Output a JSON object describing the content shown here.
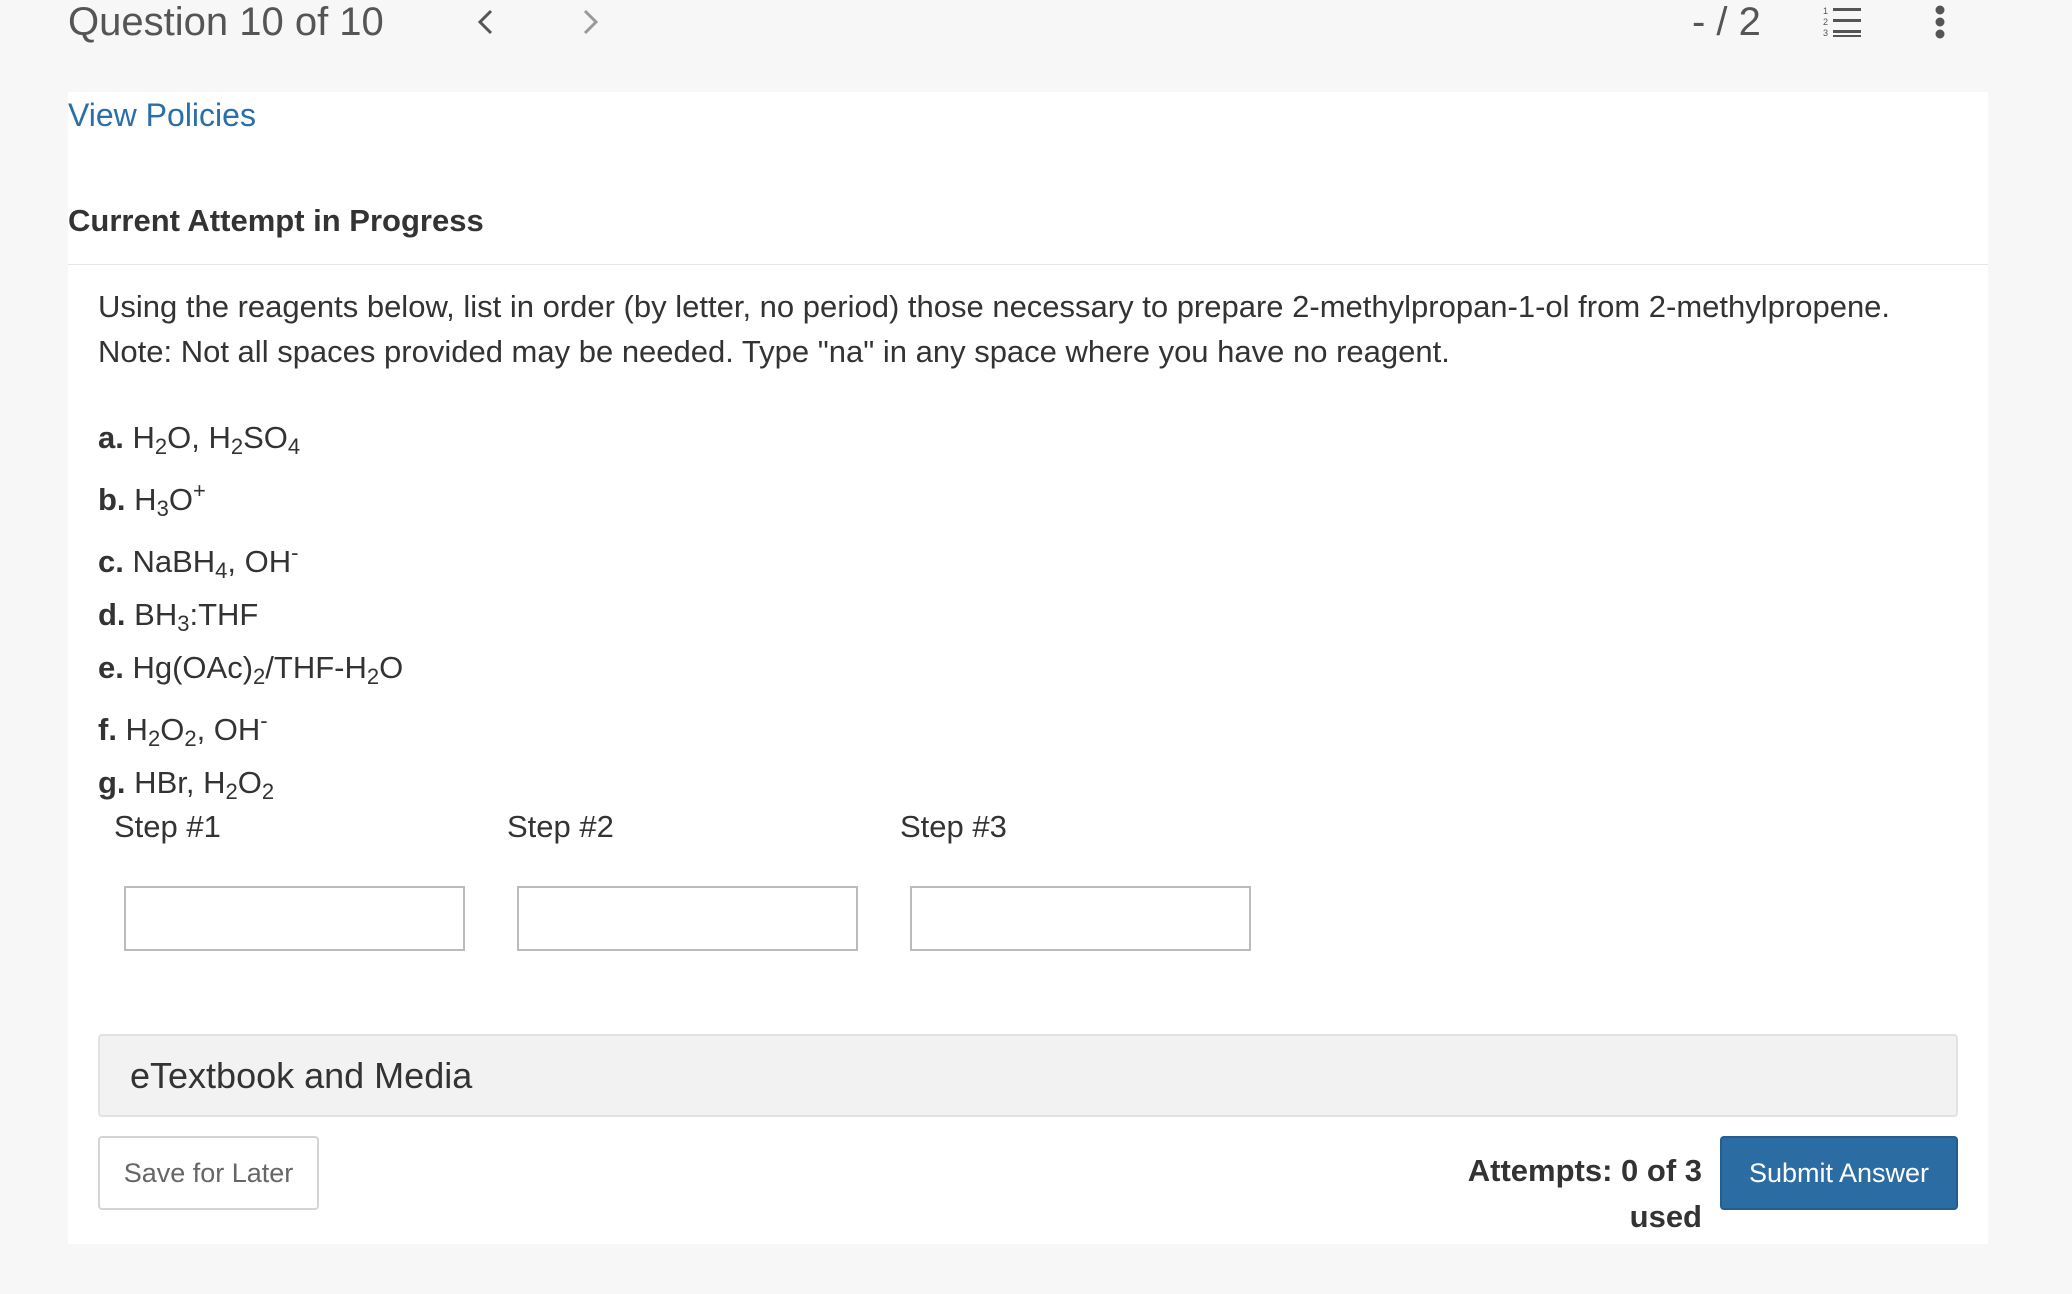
{
  "header": {
    "question_label": "Question 10 of 10",
    "score": "- / 2"
  },
  "links": {
    "view_policies": "View Policies"
  },
  "attempt_heading": "Current Attempt in Progress",
  "prompt": {
    "line1": "Using the reagents below, list in order (by letter, no period) those necessary to prepare 2-methylpropan-1-ol from 2-methylpropene.",
    "line2": "Note: Not all spaces provided may be needed. Type \"na\" in any space where you have no reagent."
  },
  "reagents": [
    {
      "letter": "a.",
      "text": "H<sub>2</sub>O, H<sub>2</sub>SO<sub>4</sub>"
    },
    {
      "letter": "b.",
      "text": "H<sub>3</sub>O<sup>+</sup>"
    },
    {
      "letter": "c.",
      "text": "NaBH<sub>4</sub>, OH<sup>-</sup>"
    },
    {
      "letter": "d.",
      "text": "BH<sub>3</sub>:THF"
    },
    {
      "letter": "e.",
      "text": "Hg(OAc)<sub>2</sub>/THF-H<sub>2</sub>O"
    },
    {
      "letter": "f.",
      "text": "H<sub>2</sub>O<sub>2</sub>, OH<sup>-</sup>"
    },
    {
      "letter": "g.",
      "text": "HBr, H<sub>2</sub>O<sub>2</sub>"
    }
  ],
  "steps": [
    {
      "label": "Step #1",
      "value": ""
    },
    {
      "label": "Step #2",
      "value": ""
    },
    {
      "label": "Step #3",
      "value": ""
    }
  ],
  "etextbook_label": "eTextbook and Media",
  "footer": {
    "save_label": "Save for Later",
    "attempts_text": "Attempts: 0 of 3 used",
    "submit_label": "Submit Answer"
  },
  "colors": {
    "accent": "#2b6da3",
    "link": "#2a6fa8"
  },
  "icons": [
    "chevron-left-icon",
    "chevron-right-icon",
    "numbered-list-icon",
    "more-vertical-icon"
  ]
}
